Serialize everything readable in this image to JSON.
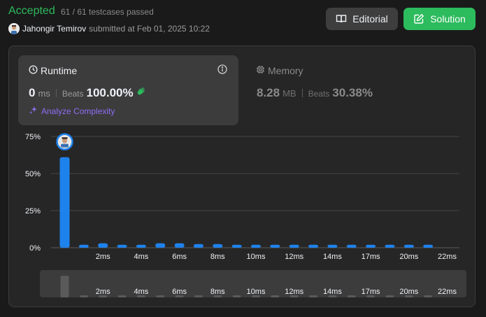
{
  "header": {
    "status": "Accepted",
    "testcases": "61 / 61 testcases passed",
    "user": "Jahongir Temirov",
    "submitted": "submitted at Feb 01, 2025 10:22",
    "editorial_label": "Editorial",
    "solution_label": "Solution"
  },
  "runtime": {
    "title": "Runtime",
    "value": "0",
    "unit": "ms",
    "beats_label": "Beats",
    "beats_value": "100.00%",
    "analyze_label": "Analyze Complexity"
  },
  "memory": {
    "title": "Memory",
    "value": "8.28",
    "unit": "MB",
    "beats_label": "Beats",
    "beats_value": "30.38%"
  },
  "colors": {
    "accepted": "#2cbb5d",
    "bar": "#1e82ec",
    "analyze": "#8f6df4"
  },
  "chart_data": {
    "type": "bar",
    "ylim": [
      0,
      75
    ],
    "yticks": [
      "75%",
      "50%",
      "25%",
      "0%"
    ],
    "ytick_values": [
      75,
      50,
      25,
      0
    ],
    "xtick_labels": [
      "2ms",
      "4ms",
      "6ms",
      "8ms",
      "10ms",
      "12ms",
      "14ms",
      "17ms",
      "20ms",
      "22ms"
    ],
    "values": [
      61,
      2,
      3,
      2,
      2,
      3,
      3,
      2.5,
      2.5,
      2,
      2,
      2,
      2,
      2,
      2,
      2,
      2,
      2,
      2,
      2
    ],
    "highlight_index": 0,
    "grid": true
  }
}
